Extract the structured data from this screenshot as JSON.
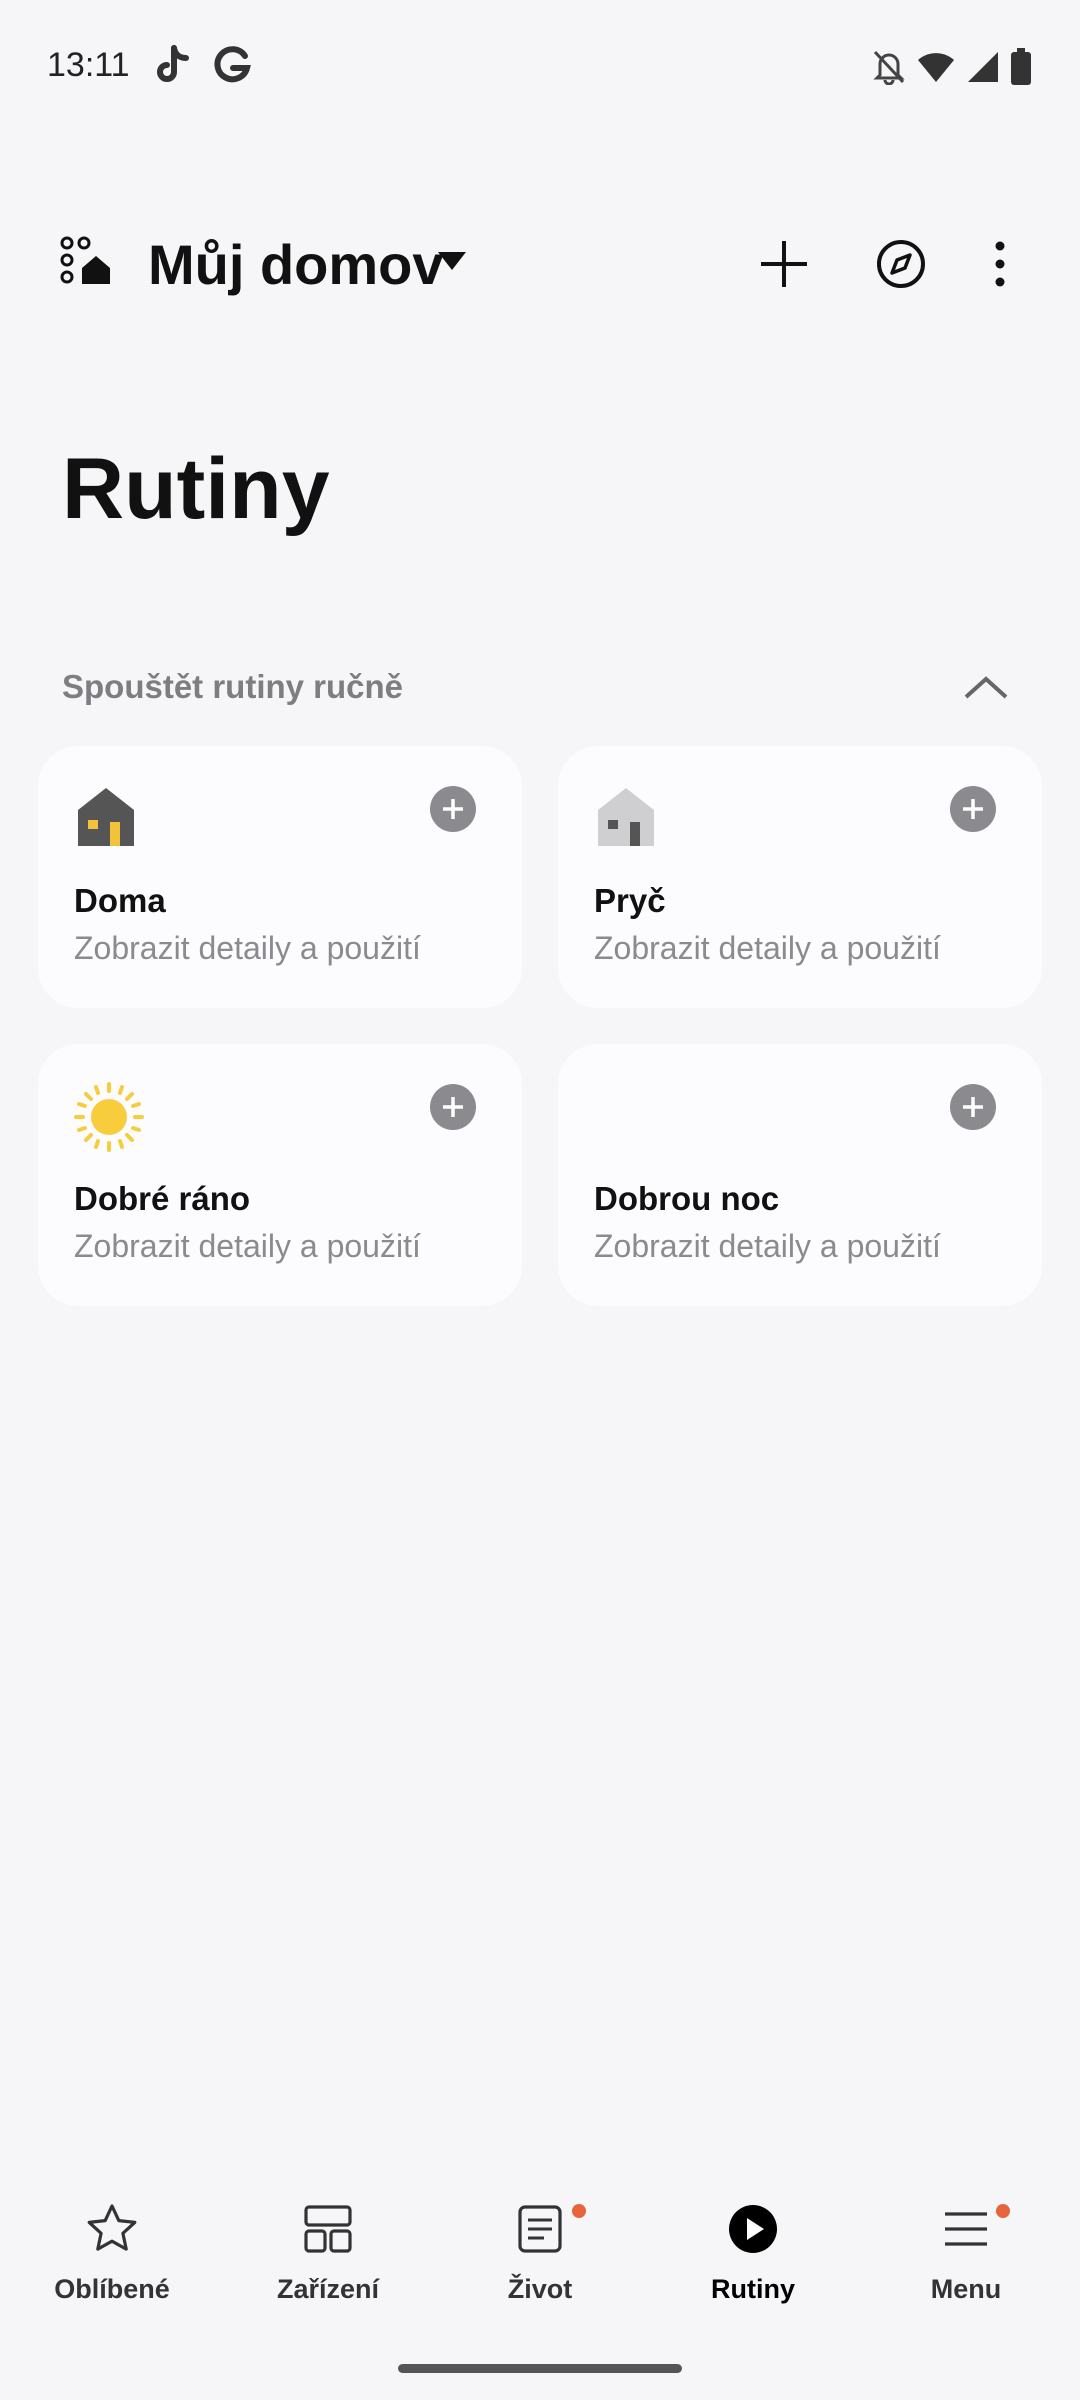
{
  "status_bar": {
    "time": "13:11",
    "left_icons": [
      "tiktok-icon",
      "google-icon"
    ],
    "right_icons": [
      "notifications-off-icon",
      "wifi-icon",
      "signal-icon",
      "battery-icon"
    ]
  },
  "header": {
    "home_name": "Můj domov",
    "actions": [
      "add-icon",
      "discover-icon",
      "more-icon"
    ]
  },
  "page": {
    "title": "Rutiny"
  },
  "section": {
    "label": "Spouštět rutiny ručně",
    "collapse_icon": "chevron-up-icon"
  },
  "routines": [
    {
      "title": "Doma",
      "subtitle": "Zobrazit detaily a použití",
      "icon": "house-home-icon"
    },
    {
      "title": "Pryč",
      "subtitle": "Zobrazit detaily a použití",
      "icon": "house-away-icon"
    },
    {
      "title": "Dobré ráno",
      "subtitle": "Zobrazit detaily a použití",
      "icon": "sun-icon"
    },
    {
      "title": "Dobrou noc",
      "subtitle": "Zobrazit detaily a použití",
      "icon": "moon-icon"
    }
  ],
  "bottom_nav": [
    {
      "label": "Oblíbené",
      "icon": "star-icon",
      "active": false,
      "badge": false
    },
    {
      "label": "Zařízení",
      "icon": "devices-grid-icon",
      "active": false,
      "badge": false
    },
    {
      "label": "Život",
      "icon": "life-icon",
      "active": false,
      "badge": true
    },
    {
      "label": "Rutiny",
      "icon": "play-icon",
      "active": true,
      "badge": false
    },
    {
      "label": "Menu",
      "icon": "menu-icon",
      "active": false,
      "badge": true
    }
  ],
  "colors": {
    "background": "#f6f6f8",
    "card": "#fcfcfe",
    "badge": "#e8643a",
    "sun": "#f7cd3c",
    "moon": "#a99cf0"
  }
}
